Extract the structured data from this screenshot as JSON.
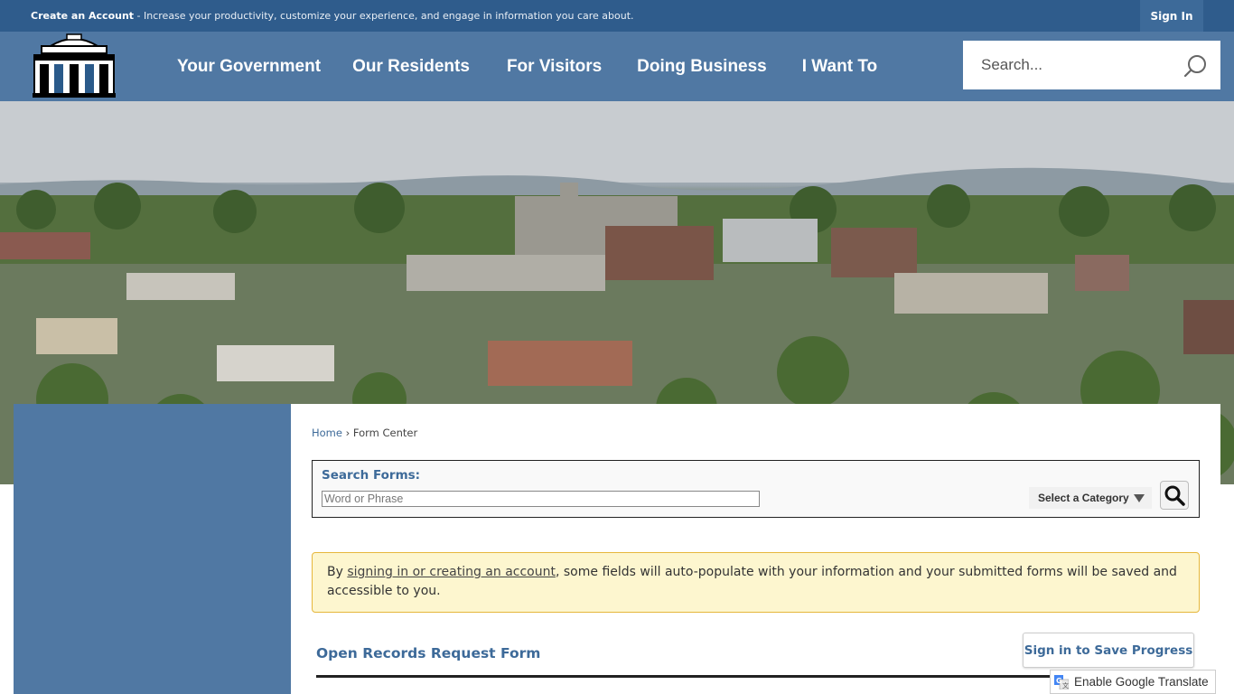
{
  "topbar": {
    "create_account_link": "Create an Account",
    "promo_text": " - Increase your productivity, customize your experience, and engage in information you care about.",
    "sign_in_label": "Sign In"
  },
  "header": {
    "nav": [
      {
        "label": "Your Government"
      },
      {
        "label": "Our Residents"
      },
      {
        "label": "For Visitors"
      },
      {
        "label": "Doing Business"
      },
      {
        "label": "I Want To"
      }
    ],
    "search_placeholder": "Search...",
    "search_icon": "search-icon"
  },
  "breadcrumb": {
    "home": "Home",
    "separator": "›",
    "current": "Form Center"
  },
  "search_forms": {
    "label": "Search Forms:",
    "placeholder": "Word or Phrase",
    "category_label": "Select a Category",
    "go_icon": "magnifier-icon"
  },
  "notice": {
    "prefix": "By ",
    "link": "signing in or creating an account",
    "suffix": ", some fields will auto-populate with your information and your submitted forms will be saved and accessible to you."
  },
  "form": {
    "title": "Open Records Request Form",
    "save_button": "Sign in to Save Progress"
  },
  "translate": {
    "label": "Enable Google Translate"
  },
  "colors": {
    "topbar": "#2f5c8c",
    "header": "#5078a3",
    "accent": "#3d6a99",
    "notice_bg": "#fdf6cf",
    "notice_border": "#e6b73c"
  }
}
